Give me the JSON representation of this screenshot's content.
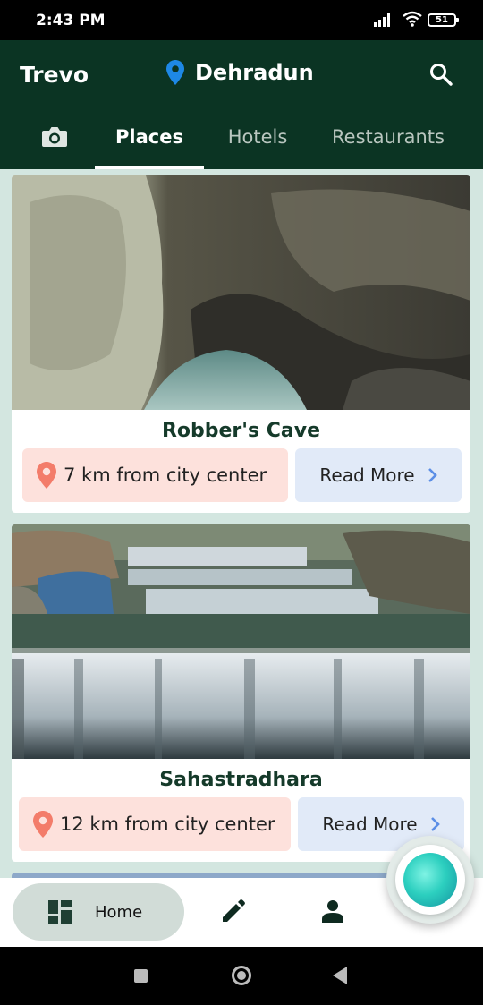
{
  "status_bar": {
    "time": "2:43 PM",
    "battery": "51"
  },
  "app_bar": {
    "brand": "Trevo",
    "location": "Dehradun"
  },
  "tabs": [
    {
      "icon": "camera-icon"
    },
    {
      "label": "Places",
      "selected": true
    },
    {
      "label": "Hotels",
      "selected": false
    },
    {
      "label": "Restaurants",
      "selected": false
    }
  ],
  "places": [
    {
      "name": "Robber's Cave",
      "distance": "7 km from city center",
      "cta": "Read More"
    },
    {
      "name": "Sahastradhara",
      "distance": "12 km from city center",
      "cta": "Read More"
    }
  ],
  "bottom_nav": {
    "home_label": "Home"
  },
  "colors": {
    "app_bar": "#0b3423",
    "background": "#d3e6e0",
    "distance_chip": "#fde1dc",
    "read_more_chip": "#e1eaf8",
    "accent_blue": "#1e88e5"
  }
}
